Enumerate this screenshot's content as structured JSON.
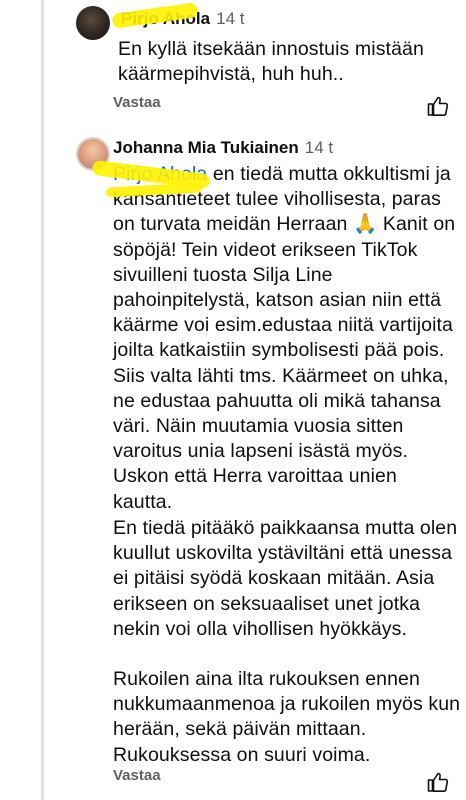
{
  "comments": [
    {
      "author": "Pirjo Ahola",
      "time": "14 t",
      "text": "En kyllä itsekään innostuis mistään käärmepihvistä, huh huh..",
      "reply": "Vastaa"
    },
    {
      "author": "Johanna Mia Tukiainen",
      "time": "14 t",
      "mention": "Pirjo Ahola",
      "text": " en tiedä mutta okkultismi ja kansantieteet tulee vihollisesta, paras on turvata meidän Herraan 🙏 Kanit on söpöjä! Tein videot erikseen TikTok sivuilleni tuosta Silja Line pahoinpitelystä, katson asian niin että käärme voi esim.edustaa niitä vartijoita joilta katkaistiin symbolisesti pää pois. Siis valta lähti tms. Käärmeet on uhka, ne edustaa pahuutta oli mikä tahansa väri. Näin muutamia vuosia sitten varoitus unia lapseni isästä myös. Uskon että Herra varoittaa unien kautta.",
      "paragraph2": "En tiedä pitääkö paikkaansa mutta olen kuullut uskovilta ystäviltäni että unessa ei pitäisi syödä koskaan mitään. Asia erikseen on seksuaaliset unet jotka nekin voi olla vihollisen hyökkäys.",
      "paragraph3": "Rukoilen aina ilta rukouksen ennen nukkumaanmenoa ja rukoilen myös kun herään, sekä päivän mittaan. Rukouksessa on suuri voima.",
      "reply": "Vastaa"
    }
  ],
  "colors": {
    "mention": "#1565c0",
    "highlighter": "#fff200",
    "secondary_text": "#606060"
  },
  "icons": [
    "avatar",
    "thumbs-up-icon"
  ]
}
